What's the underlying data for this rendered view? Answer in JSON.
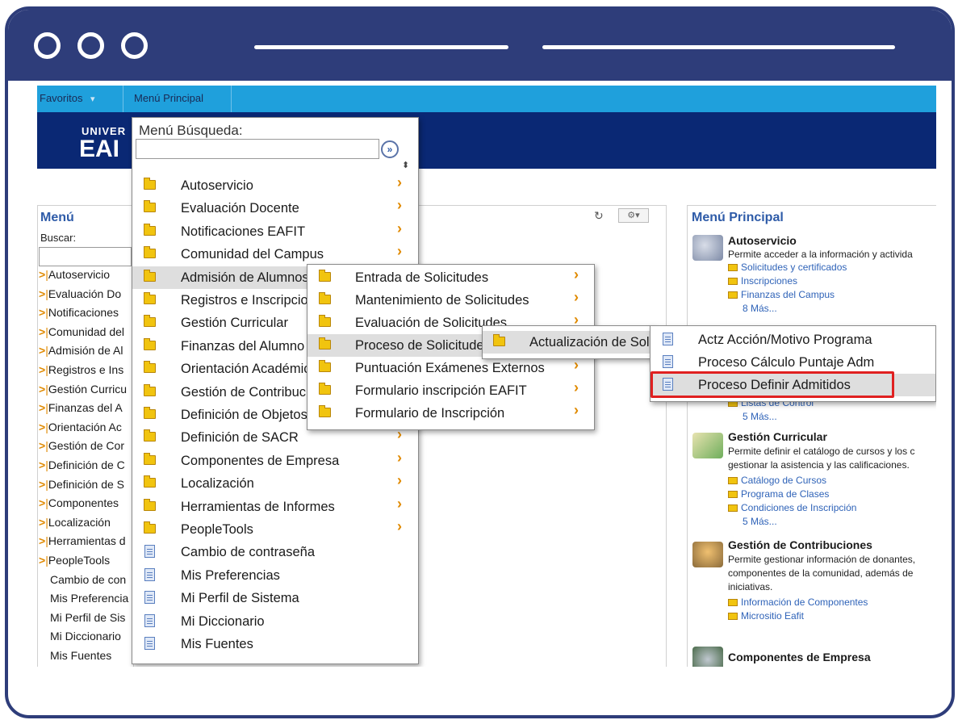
{
  "top_nav": {
    "favorites": "Favoritos",
    "main_menu": "Menú Principal"
  },
  "logo": {
    "line1": "UNIVER",
    "line2": "EAI"
  },
  "left_panel": {
    "title": "Menú",
    "search_label": "Buscar:",
    "items": [
      "Autoservicio",
      "Evaluación Do",
      "Notificaciones",
      "Comunidad del",
      "Admisión de Al",
      "Registros e Ins",
      "Gestión Curricu",
      "Finanzas del A",
      "Orientación Ac",
      "Gestión de Cor",
      "Definición de C",
      "Definición de S",
      "Componentes",
      "Localización",
      "Herramientas d",
      "PeopleTools"
    ],
    "plain_items": [
      "Cambio de con",
      "Mis Preferencia",
      "Mi Perfil de Sis",
      "Mi Diccionario",
      "Mis Fuentes"
    ]
  },
  "menu1": {
    "search_label": "Menú Búsqueda:",
    "search_value": "",
    "folders": [
      "Autoservicio",
      "Evaluación Docente",
      "Notificaciones EAFIT",
      "Comunidad del Campus",
      "Admisión de Alumnos",
      "Registros e Inscripciones",
      "Gestión Curricular",
      "Finanzas del Alumno",
      "Orientación Académica",
      "Gestión de Contribuciones",
      "Definición de Objetos",
      "Definición de SACR",
      "Componentes de Empresa",
      "Localización",
      "Herramientas de Informes",
      "PeopleTools"
    ],
    "docs": [
      "Cambio de contraseña",
      "Mis Preferencias",
      "Mi Perfil de Sistema",
      "Mi Diccionario",
      "Mis Fuentes"
    ]
  },
  "menu2": {
    "items": [
      "Entrada de Solicitudes",
      "Mantenimiento de Solicitudes",
      "Evaluación de Solicitudes",
      "Proceso de Solicitudes",
      "Puntuación Exámenes Externos",
      "Formulario inscripción EAFIT",
      "Formulario de Inscripción"
    ]
  },
  "menu3": {
    "items": [
      "Actualización de Solicitudes"
    ]
  },
  "menu4": {
    "items": [
      "Actz Acción/Motivo Programa",
      "Proceso Cálculo Puntaje Adm",
      "Proceso Definir Admitidos"
    ]
  },
  "right_panel": {
    "title": "Menú Principal",
    "autoservicio": {
      "title": "Autoservicio",
      "desc": "Permite acceder a la información y activida",
      "links": [
        "Solicitudes y certificados",
        "Inscripciones",
        "Finanzas del Campus"
      ],
      "more": "8 Más..."
    },
    "admision": {
      "links": [
        "Listas de Control"
      ],
      "more": "5 Más..."
    },
    "gestion_curricular": {
      "title": "Gestión Curricular",
      "desc": [
        "Permite definir el catálogo de cursos y los c",
        "gestionar la asistencia y las calificaciones."
      ],
      "links": [
        "Catálogo de Cursos",
        "Programa de Clases",
        "Condiciones de Inscripción"
      ],
      "more": "5 Más..."
    },
    "gestion_contribuciones": {
      "title": "Gestión de Contribuciones",
      "desc": [
        "Permite gestionar información de donantes,",
        "componentes de la comunidad, además de",
        "iniciativas."
      ],
      "links": [
        "Información de Componentes",
        "Micrositio Eafit"
      ]
    },
    "componentes": {
      "title": "Componentes de Empresa"
    }
  },
  "colors": {
    "frame": "#2e3d7a",
    "nav": "#1fa0dc",
    "banner": "#0a2874",
    "highlight_box": "#e02020"
  }
}
